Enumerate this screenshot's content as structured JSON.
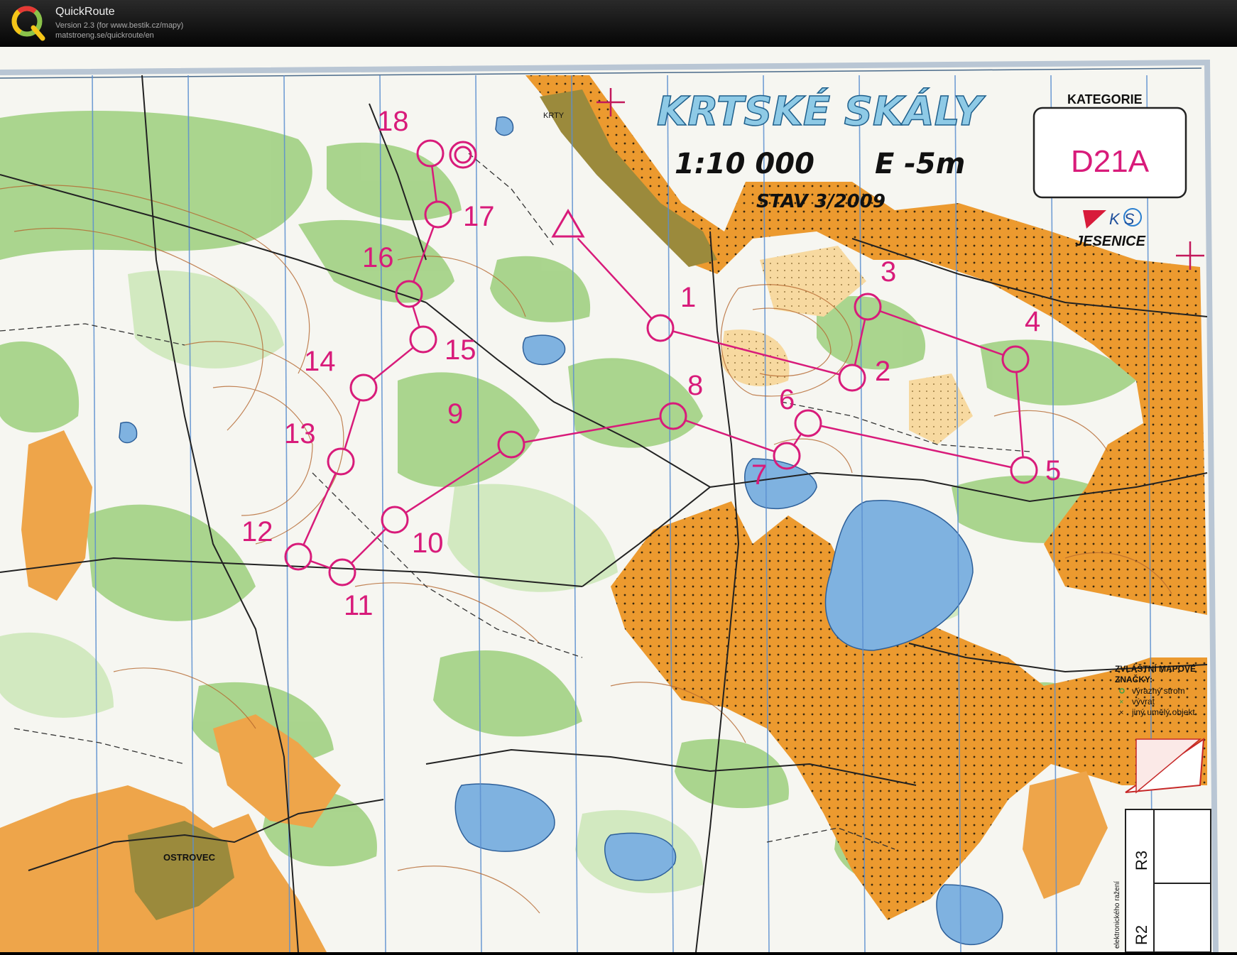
{
  "app": {
    "name": "QuickRoute",
    "version": "Version 2.3  (for www.bestik.cz/mapy)",
    "url": "matstroeng.se/quickroute/en"
  },
  "map": {
    "title": "KRTSKÉ SKÁLY",
    "scale": "1:10 000",
    "equidistance": "E -5m",
    "status": "STAV 3/2009",
    "category_label": "KATEGORIE",
    "category": "D21A",
    "club_top": "K  S",
    "club": "JESENICE",
    "village_top": "KRTY",
    "village": "OSTROVEC",
    "special_title_1": "ZVLÁŠTNÍ MAPOVÉ",
    "special_title_2": "ZNAČKY:",
    "legend": [
      "výrazný strom",
      "vývrat",
      "jiný umělý objekt"
    ],
    "side_r3": "R3",
    "side_r2": "R2",
    "side_note": "elektronického ražení",
    "course_color": "#d81b7a"
  },
  "course": {
    "controls": [
      {
        "label": "1"
      },
      {
        "label": "2"
      },
      {
        "label": "3"
      },
      {
        "label": "4"
      },
      {
        "label": "5"
      },
      {
        "label": "6"
      },
      {
        "label": "7"
      },
      {
        "label": "8"
      },
      {
        "label": "9"
      },
      {
        "label": "10"
      },
      {
        "label": "11"
      },
      {
        "label": "12"
      },
      {
        "label": "13"
      },
      {
        "label": "14"
      },
      {
        "label": "15"
      },
      {
        "label": "16"
      },
      {
        "label": "17"
      },
      {
        "label": "18"
      }
    ]
  }
}
